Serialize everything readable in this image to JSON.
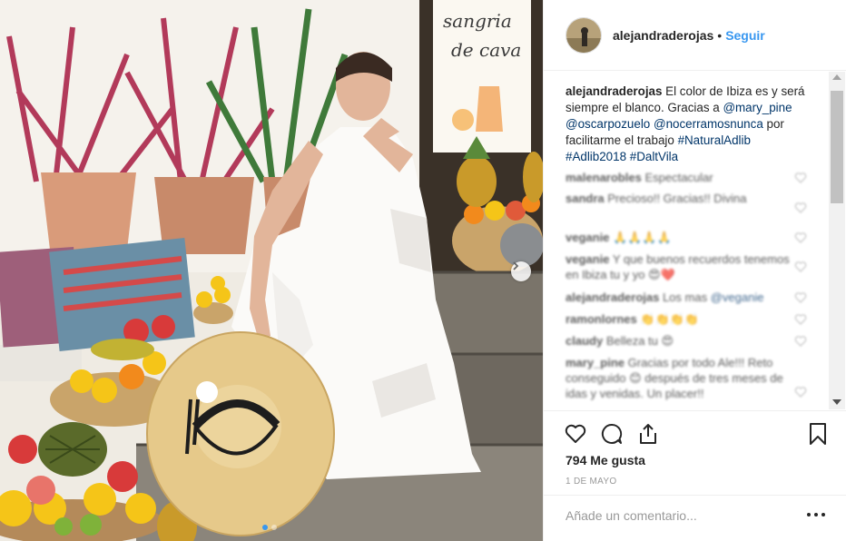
{
  "post": {
    "username": "alejandraderojas",
    "separator": "•",
    "follow_label": "Seguir"
  },
  "caption": {
    "username": "alejandraderojas",
    "text_1": "El color de Ibiza es y será siempre el blanco. Gracias a",
    "mention_1": "@mary_pine",
    "mention_2": "@oscarpozuelo",
    "mention_3": "@nocerramosnunca",
    "text_2": "por facilitarme el trabajo",
    "hashtag_1": "#NaturalAdlib",
    "hashtag_2": "#Adlib2018",
    "hashtag_3": "#DaltVila"
  },
  "comments": [
    {
      "user": "malenarobles",
      "text": "Espectacular"
    },
    {
      "user": "sandra",
      "text": "Precioso!! Gracias!! Divina"
    },
    {
      "user": "veganie",
      "text": "🙏🙏🙏🙏"
    },
    {
      "user": "veganie",
      "text": "Y que buenos recuerdos tenemos en Ibiza tu y yo 😍❤️"
    },
    {
      "user": "alejandraderojas",
      "text": "Los mas",
      "mention": "@veganie"
    },
    {
      "user": "ramonlornes",
      "text": "👏👏👏👏"
    },
    {
      "user": "claudy",
      "text": "Belleza tu 😍"
    },
    {
      "user": "mary_pine",
      "text": "Gracias por todo Ale!!! Reto conseguido 😊 después de tres meses de idas y venidas. Un placer!!"
    }
  ],
  "photo": {
    "sign_text_1": "sangria",
    "sign_text_2": "de cava"
  },
  "actions": {
    "likes": "794 Me gusta",
    "date": "1 DE MAYO",
    "comment_placeholder": "Añade un comentario..."
  },
  "colors": {
    "link": "#003569",
    "follow": "#3897f0",
    "muted": "#999999",
    "border": "#efefef"
  },
  "icons": [
    "heart-icon",
    "comment-icon",
    "share-icon",
    "bookmark-icon",
    "more-options-icon",
    "chevron-right-icon"
  ]
}
